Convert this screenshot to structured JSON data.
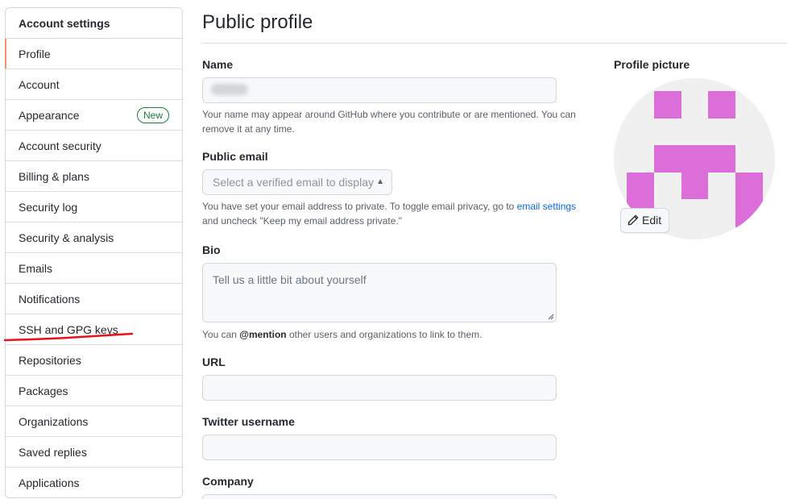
{
  "sidebar": {
    "heading": "Account settings",
    "items": [
      {
        "label": "Profile",
        "selected": true
      },
      {
        "label": "Account"
      },
      {
        "label": "Appearance",
        "badge": "New"
      },
      {
        "label": "Account security"
      },
      {
        "label": "Billing & plans"
      },
      {
        "label": "Security log"
      },
      {
        "label": "Security & analysis"
      },
      {
        "label": "Emails"
      },
      {
        "label": "Notifications"
      },
      {
        "label": "SSH and GPG keys",
        "annotated": true
      },
      {
        "label": "Repositories"
      },
      {
        "label": "Packages"
      },
      {
        "label": "Organizations"
      },
      {
        "label": "Saved replies"
      },
      {
        "label": "Applications"
      }
    ]
  },
  "main": {
    "title": "Public profile",
    "name": {
      "label": "Name",
      "note": "Your name may appear around GitHub where you contribute or are mentioned. You can remove it at any time."
    },
    "public_email": {
      "label": "Public email",
      "placeholder": "Select a verified email to display",
      "note_before": "You have set your email address to private. To toggle email privacy, go to ",
      "note_link": "email settings",
      "note_after": " and uncheck \"Keep my email address private.\""
    },
    "bio": {
      "label": "Bio",
      "placeholder": "Tell us a little bit about yourself",
      "note_before": "You can ",
      "note_mention": "@mention",
      "note_after": " other users and organizations to link to them."
    },
    "url": {
      "label": "URL"
    },
    "twitter": {
      "label": "Twitter username"
    },
    "company": {
      "label": "Company"
    }
  },
  "profile_picture": {
    "label": "Profile picture",
    "edit_label": "Edit",
    "identicon_color": "#db6ed9"
  },
  "colors": {
    "selected_accent": "#fd8c73",
    "new_badge": "#1a7f37",
    "link": "#0969da",
    "annotation_underline": "#e8121a"
  }
}
